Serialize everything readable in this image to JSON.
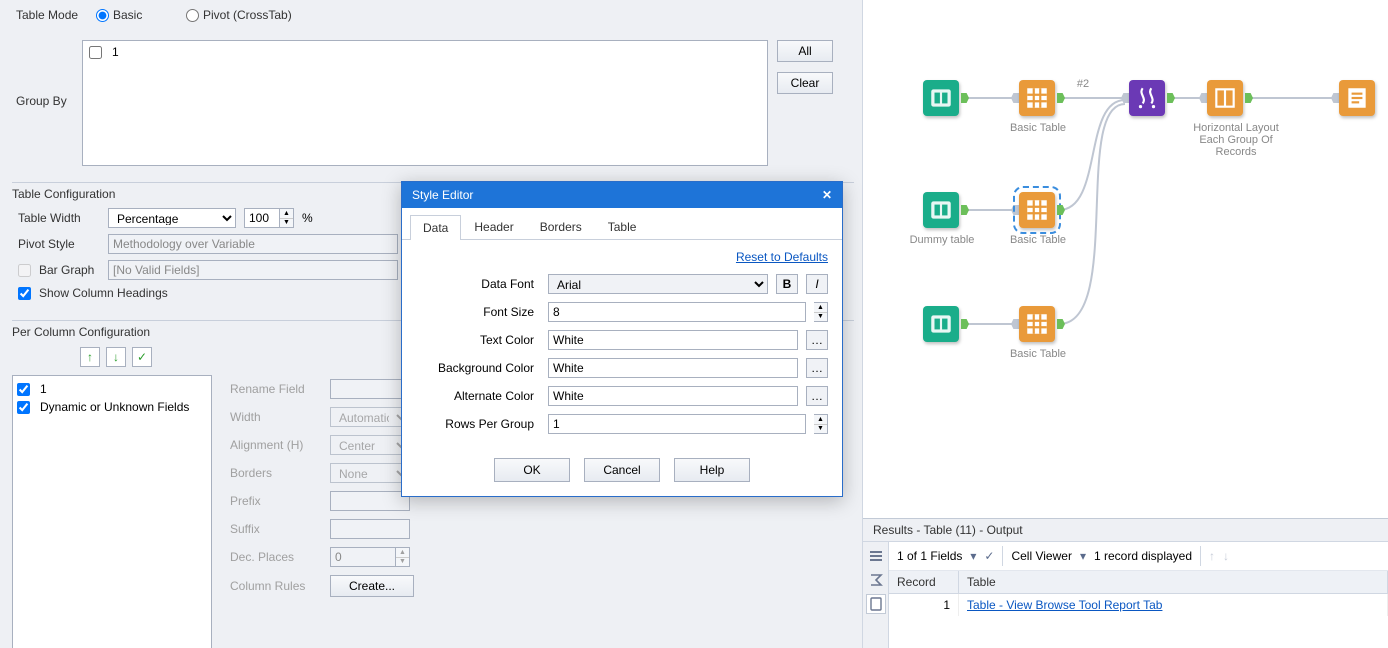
{
  "tableMode": {
    "label": "Table Mode",
    "basic": "Basic",
    "pivot": "Pivot (CrossTab)"
  },
  "groupBy": {
    "label": "Group By",
    "items": [
      "1"
    ],
    "allBtn": "All",
    "clearBtn": "Clear"
  },
  "tableConfig": {
    "title": "Table Configuration",
    "tableWidth": {
      "label": "Table Width",
      "mode": "Percentage",
      "value": "100",
      "unit": "%"
    },
    "pivotStyle": {
      "label": "Pivot Style",
      "value": "Methodology over Variable"
    },
    "barGraph": {
      "label": "Bar Graph",
      "value": "[No Valid Fields]"
    },
    "showColHeadings": "Show Column Headings"
  },
  "perColumn": {
    "title": "Per Column Configuration",
    "listItems": [
      "1",
      "Dynamic or Unknown Fields"
    ],
    "fields": {
      "rename": "Rename Field",
      "width": {
        "label": "Width",
        "value": "Automatic"
      },
      "alignment": {
        "label": "Alignment (H)",
        "value": "Center"
      },
      "borders": {
        "label": "Borders",
        "value": "None"
      },
      "prefix": "Prefix",
      "suffix": "Suffix",
      "decPlaces": {
        "label": "Dec. Places",
        "value": "0"
      },
      "columnRules": {
        "label": "Column Rules",
        "button": "Create..."
      }
    }
  },
  "styleEditor": {
    "title": "Style Editor",
    "tabs": [
      "Data",
      "Header",
      "Borders",
      "Table"
    ],
    "reset": "Reset to Defaults",
    "rows": {
      "dataFont": {
        "label": "Data Font",
        "value": "Arial"
      },
      "fontSize": {
        "label": "Font Size",
        "value": "8"
      },
      "textColor": {
        "label": "Text Color",
        "value": "White"
      },
      "bgColor": {
        "label": "Background Color",
        "value": "White"
      },
      "altColor": {
        "label": "Alternate Color",
        "value": "White"
      },
      "rowsPerGroup": {
        "label": "Rows Per Group",
        "value": "1"
      }
    },
    "buttons": {
      "ok": "OK",
      "cancel": "Cancel",
      "help": "Help"
    }
  },
  "canvas": {
    "labels": {
      "basicTable1": "Basic Table",
      "dummy": "Dummy table",
      "basicTable2": "Basic Table",
      "basicTable3": "Basic Table",
      "hlayout": "Horizontal Layout Each Group Of Records",
      "hash2": "#2"
    }
  },
  "results": {
    "title": "Results - Table (11) - Output",
    "fields": "1 of 1 Fields",
    "cellViewer": "Cell Viewer",
    "recordsDisplayed": "1 record displayed",
    "headers": {
      "record": "Record",
      "table": "Table"
    },
    "row": {
      "record": "1",
      "link": "Table - View Browse Tool Report Tab"
    }
  }
}
